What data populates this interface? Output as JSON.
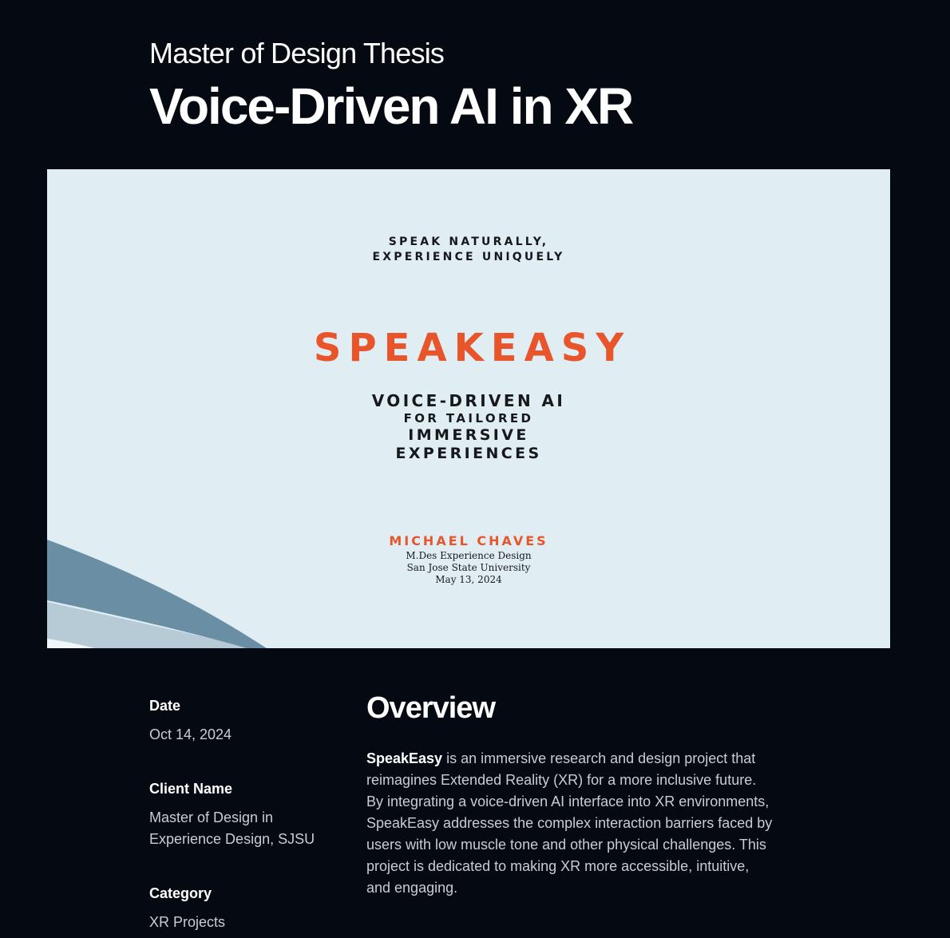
{
  "header": {
    "eyebrow": "Master of Design Thesis",
    "title": "Voice-Driven AI in XR"
  },
  "hero": {
    "tagline_line1": "SPEAK NATURALLY,",
    "tagline_line2": "EXPERIENCE UNIQUELY",
    "brand": "SPEAKEASY",
    "subtitle_line1": "VOICE-DRIVEN AI",
    "subtitle_line2": "FOR TAILORED",
    "subtitle_line3": "IMMERSIVE",
    "subtitle_line4": "EXPERIENCES",
    "author": "MICHAEL CHAVES",
    "degree": "M.Des Experience Design",
    "university": "San Jose State University",
    "date": "May 13, 2024",
    "colors": {
      "background": "#e0eef4",
      "accent": "#e8552b",
      "wave_dark": "#6a8ea3",
      "wave_light": "#b7cbd7"
    }
  },
  "details": {
    "date_label": "Date",
    "date_value": "Oct 14, 2024",
    "client_label": "Client Name",
    "client_value_line1": "Master of Design in",
    "client_value_line2": "Experience Design, SJSU",
    "category_label": "Category",
    "category_value": "XR Projects"
  },
  "overview": {
    "title": "Overview",
    "lead": "SpeakEasy",
    "body": " is an immersive research and design project that reimagines Extended Reality (XR) for a more inclusive future. By integrating a voice-driven AI interface into XR environments, SpeakEasy addresses the complex interaction barriers faced by users with low muscle tone and other physical challenges. This project is dedicated to making XR more accessible, intuitive, and engaging."
  }
}
